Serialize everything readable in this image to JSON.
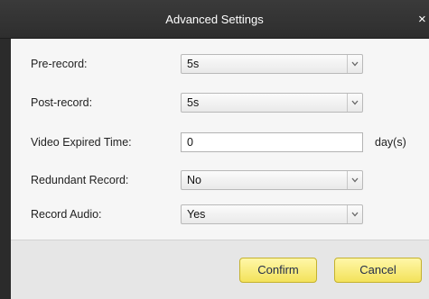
{
  "dialog": {
    "title": "Advanced Settings",
    "close_label": "×"
  },
  "fields": {
    "pre_record": {
      "label": "Pre-record:",
      "value": "5s"
    },
    "post_record": {
      "label": "Post-record:",
      "value": "5s"
    },
    "video_expired_time": {
      "label": "Video Expired Time:",
      "value": "0",
      "unit": "day(s)"
    },
    "redundant_record": {
      "label": "Redundant Record:",
      "value": "No"
    },
    "record_audio": {
      "label": "Record Audio:",
      "value": "Yes"
    }
  },
  "buttons": {
    "confirm_label": "Confirm",
    "cancel_label": "Cancel"
  },
  "icons": {
    "dropdown": "chevron-down-icon",
    "close": "close-icon"
  },
  "colors": {
    "titlebar": "#333333",
    "content_bg": "#f6f6f6",
    "button_fill": "#f3e25a",
    "button_border": "#c4b22e"
  }
}
